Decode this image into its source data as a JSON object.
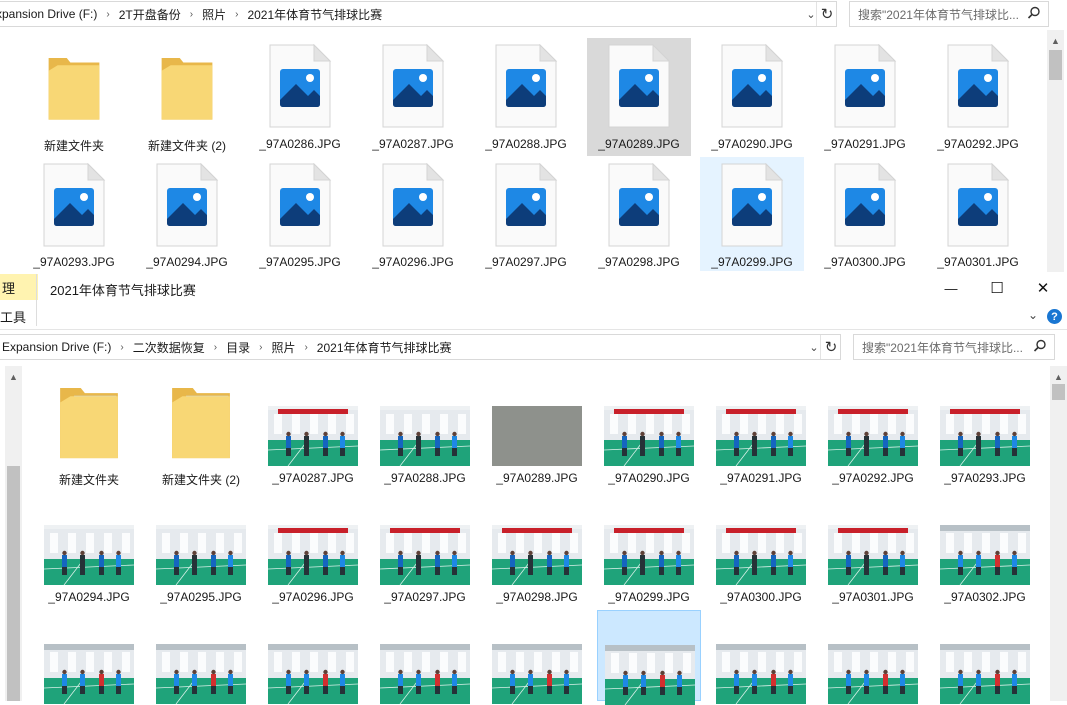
{
  "top_window": {
    "breadcrumbs": [
      "Expansion Drive (F:)",
      "2T开盘备份",
      "照片",
      "2021年体育节气排球比赛"
    ],
    "search_placeholder": "搜索\"2021年体育节气排球比...",
    "items": [
      {
        "name": "新建文件夹",
        "type": "folder"
      },
      {
        "name": "新建文件夹 (2)",
        "type": "folder"
      },
      {
        "name": "_97A0286.JPG",
        "type": "image"
      },
      {
        "name": "_97A0287.JPG",
        "type": "image"
      },
      {
        "name": "_97A0288.JPG",
        "type": "image"
      },
      {
        "name": "_97A0289.JPG",
        "type": "image",
        "state": "selected-inactive"
      },
      {
        "name": "_97A0290.JPG",
        "type": "image"
      },
      {
        "name": "_97A0291.JPG",
        "type": "image"
      },
      {
        "name": "_97A0292.JPG",
        "type": "image"
      },
      {
        "name": "_97A0293.JPG",
        "type": "image"
      },
      {
        "name": "_97A0294.JPG",
        "type": "image"
      },
      {
        "name": "_97A0295.JPG",
        "type": "image"
      },
      {
        "name": "_97A0296.JPG",
        "type": "image"
      },
      {
        "name": "_97A0297.JPG",
        "type": "image"
      },
      {
        "name": "_97A0298.JPG",
        "type": "image"
      },
      {
        "name": "_97A0299.JPG",
        "type": "image",
        "state": "hover"
      },
      {
        "name": "_97A0300.JPG",
        "type": "image"
      },
      {
        "name": "_97A0301.JPG",
        "type": "image"
      }
    ]
  },
  "bottom_window": {
    "title": "2021年体育节气排球比赛",
    "ribbon_fragments": [
      "理",
      "工具"
    ],
    "window_controls": {
      "minimize": "—",
      "maximize": "☐",
      "close": "✕"
    },
    "breadcrumbs": [
      "Expansion Drive (F:)",
      "二次数据恢复",
      "目录",
      "照片",
      "2021年体育节气排球比赛"
    ],
    "search_placeholder": "搜索\"2021年体育节气排球比...",
    "items": [
      {
        "name": "新建文件夹",
        "type": "folder"
      },
      {
        "name": "新建文件夹 (2)",
        "type": "folder"
      },
      {
        "name": "_97A0287.JPG",
        "type": "photo",
        "scene": "red-banner"
      },
      {
        "name": "_97A0288.JPG",
        "type": "photo",
        "scene": "blue-players"
      },
      {
        "name": "_97A0289.JPG",
        "type": "photo",
        "scene": "gray"
      },
      {
        "name": "_97A0290.JPG",
        "type": "photo",
        "scene": "red-banner"
      },
      {
        "name": "_97A0291.JPG",
        "type": "photo",
        "scene": "red-banner"
      },
      {
        "name": "_97A0292.JPG",
        "type": "photo",
        "scene": "red-banner"
      },
      {
        "name": "_97A0293.JPG",
        "type": "photo",
        "scene": "red-banner"
      },
      {
        "name": "_97A0294.JPG",
        "type": "photo",
        "scene": "blue-players"
      },
      {
        "name": "_97A0295.JPG",
        "type": "photo",
        "scene": "blue-players"
      },
      {
        "name": "_97A0296.JPG",
        "type": "photo",
        "scene": "red-banner"
      },
      {
        "name": "_97A0297.JPG",
        "type": "photo",
        "scene": "red-banner"
      },
      {
        "name": "_97A0298.JPG",
        "type": "photo",
        "scene": "red-banner"
      },
      {
        "name": "_97A0299.JPG",
        "type": "photo",
        "scene": "red-banner"
      },
      {
        "name": "_97A0300.JPG",
        "type": "photo",
        "scene": "red-banner"
      },
      {
        "name": "_97A0301.JPG",
        "type": "photo",
        "scene": "red-banner"
      },
      {
        "name": "_97A0302.JPG",
        "type": "photo",
        "scene": "hall"
      },
      {
        "name": "",
        "type": "photo",
        "scene": "hall"
      },
      {
        "name": "",
        "type": "photo",
        "scene": "hall"
      },
      {
        "name": "",
        "type": "photo",
        "scene": "hall"
      },
      {
        "name": "",
        "type": "photo",
        "scene": "hall"
      },
      {
        "name": "",
        "type": "photo",
        "scene": "hall"
      },
      {
        "name": "",
        "type": "photo",
        "scene": "hall",
        "state": "selected"
      },
      {
        "name": "",
        "type": "photo",
        "scene": "hall"
      },
      {
        "name": "",
        "type": "photo",
        "scene": "hall"
      },
      {
        "name": "",
        "type": "photo",
        "scene": "hall"
      }
    ]
  },
  "colors": {
    "folder": "#f8d775",
    "folder_dark": "#e8b74a",
    "image_icon_blue": "#1e88e5",
    "selection_blue": "#cce8ff",
    "selection_gray": "#d9d9d9",
    "court_green": "#1fa37a",
    "banner_red": "#c8202a",
    "help_blue": "#1976d2"
  }
}
